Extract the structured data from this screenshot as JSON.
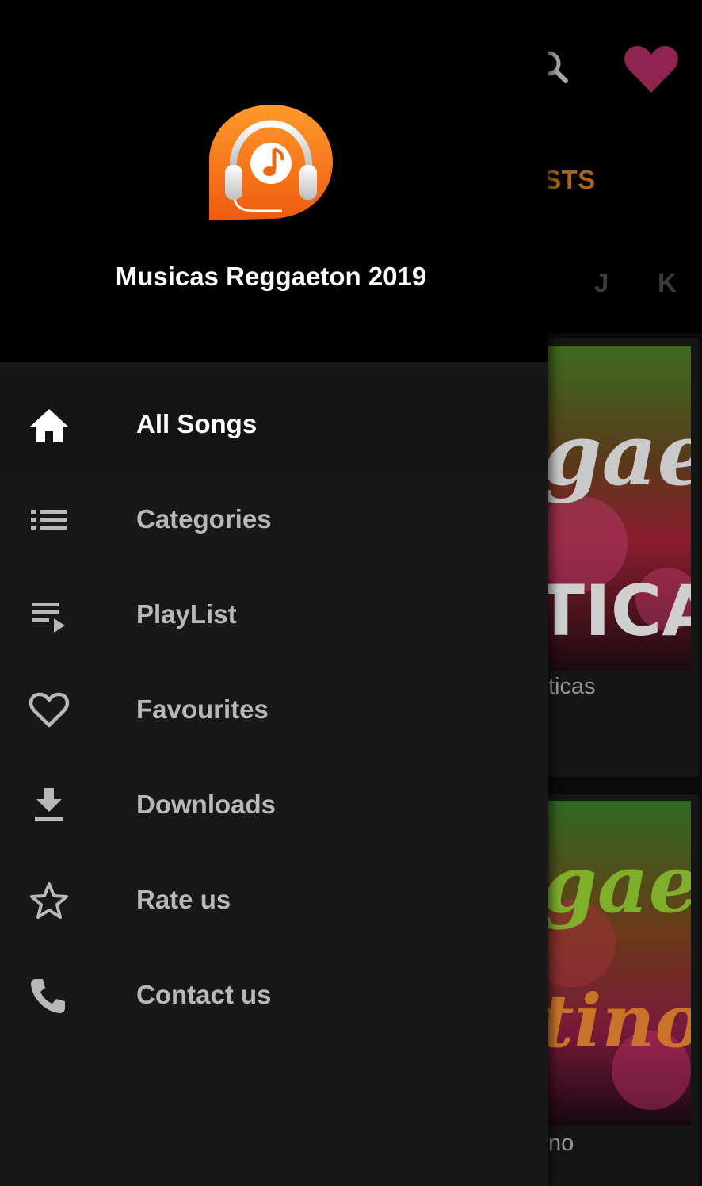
{
  "background": {
    "tab_partial": "AYLISTS",
    "letters": [
      "J",
      "K"
    ],
    "cards": [
      {
        "label": "ticas",
        "art_text_top": "gae",
        "art_text_bottom": "TICAS"
      },
      {
        "label": "no",
        "art_text_top": "gae",
        "art_text_bottom": "tino"
      }
    ],
    "accent_color": "#a8651e",
    "heart_color": "#8e2450"
  },
  "drawer": {
    "app_name": "Musicas Reggaeton 2019",
    "logo_icon": "headphones-music-icon",
    "items": [
      {
        "label": "All Songs",
        "icon": "home-icon",
        "active": true
      },
      {
        "label": "Categories",
        "icon": "list-icon",
        "active": false
      },
      {
        "label": "PlayList",
        "icon": "playlist-icon",
        "active": false
      },
      {
        "label": "Favourites",
        "icon": "heart-outline-icon",
        "active": false
      },
      {
        "label": "Downloads",
        "icon": "download-icon",
        "active": false
      },
      {
        "label": "Rate us",
        "icon": "star-outline-icon",
        "active": false
      },
      {
        "label": "Contact us",
        "icon": "phone-icon",
        "active": false
      }
    ]
  }
}
